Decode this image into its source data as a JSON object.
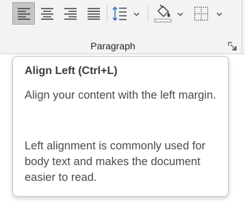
{
  "ribbon": {
    "group_label": "Paragraph",
    "buttons": [
      {
        "name": "align-left",
        "icon": "align-left-icon",
        "selected": true
      },
      {
        "name": "center",
        "icon": "align-center-icon",
        "selected": false
      },
      {
        "name": "align-right",
        "icon": "align-right-icon",
        "selected": false
      },
      {
        "name": "justify",
        "icon": "justify-icon",
        "selected": false
      },
      {
        "name": "line-spacing",
        "icon": "line-spacing-icon",
        "has_dropdown": true
      },
      {
        "name": "shading",
        "icon": "paint-bucket-icon",
        "has_dropdown": true
      },
      {
        "name": "borders",
        "icon": "borders-icon",
        "has_dropdown": true
      }
    ],
    "launcher_icon": "dialog-launcher-icon"
  },
  "tooltip": {
    "title": "Align Left (Ctrl+L)",
    "description": "Align your content with the left margin.",
    "detail": "Left alignment is commonly used for body text and makes the document easier to read."
  },
  "colors": {
    "ribbon_background": "#f3f3f3",
    "selected_button": "#c5c5c5",
    "line_spacing_accent": "#2b6cc4",
    "tooltip_border": "#c6c6c6"
  }
}
